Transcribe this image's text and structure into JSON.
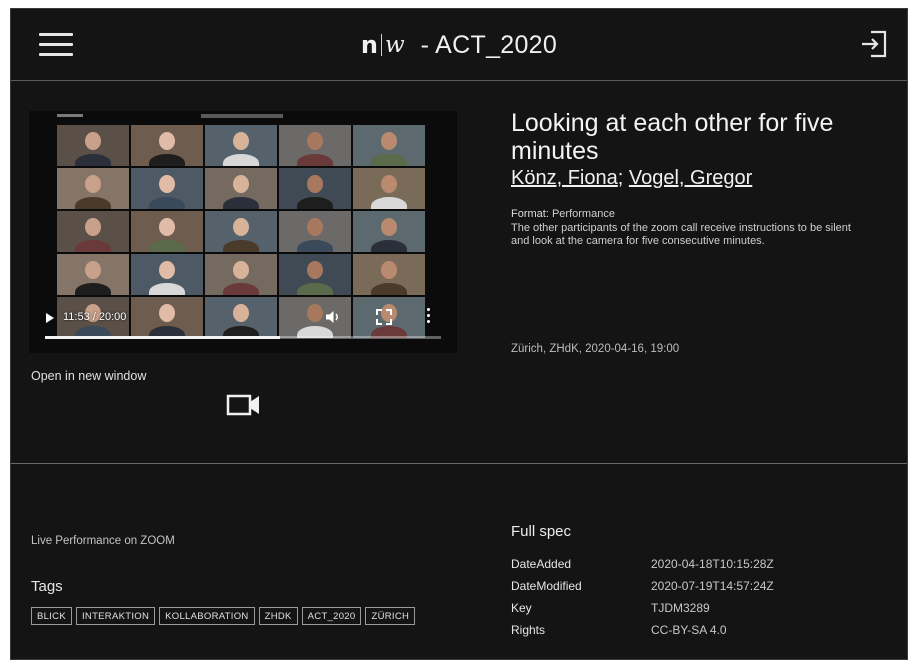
{
  "header": {
    "logo_n": "n",
    "logo_w": "w",
    "title": "- ACT_2020",
    "menu_icon": "hamburger-menu-icon",
    "login_icon": "sign-in-icon"
  },
  "video": {
    "time": "11:53 / 20:00",
    "progress_fraction": 0.594,
    "icons": [
      "play-icon",
      "volume-icon",
      "fullscreen-icon",
      "more-options-icon"
    ]
  },
  "media_link": {
    "label": "Open in new window",
    "icon": "video-camera-icon"
  },
  "work": {
    "title": "Looking at each other for five minutes",
    "authors": [
      "Könz, Fiona",
      "Vogel, Gregor"
    ],
    "author_separator": ";",
    "format_label": "Format:",
    "format_value": "Performance",
    "description": "The other participants of the zoom call receive instructions to be silent and look at the camera for five consecutive minutes.",
    "place_date": "Zürich, ZHdK, 2020-04-16, 19:00"
  },
  "details": {
    "live_note": "Live Performance on ZOOM",
    "tags_heading": "Tags",
    "tags": [
      "BLICK",
      "INTERAKTION",
      "KOLLABORATION",
      "ZHDK",
      "ACT_2020",
      "ZÜRICH"
    ]
  },
  "spec": {
    "heading": "Full spec",
    "rows": [
      {
        "key": "DateAdded",
        "value": "2020-04-18T10:15:28Z"
      },
      {
        "key": "DateModified",
        "value": "2020-07-19T14:57:24Z"
      },
      {
        "key": "Key",
        "value": "TJDM3289"
      },
      {
        "key": "Rights",
        "value": "CC-BY-SA 4.0"
      }
    ]
  },
  "colors": {
    "background": "#141414",
    "text": "#e8e8e8",
    "divider": "#6a6a6a"
  }
}
